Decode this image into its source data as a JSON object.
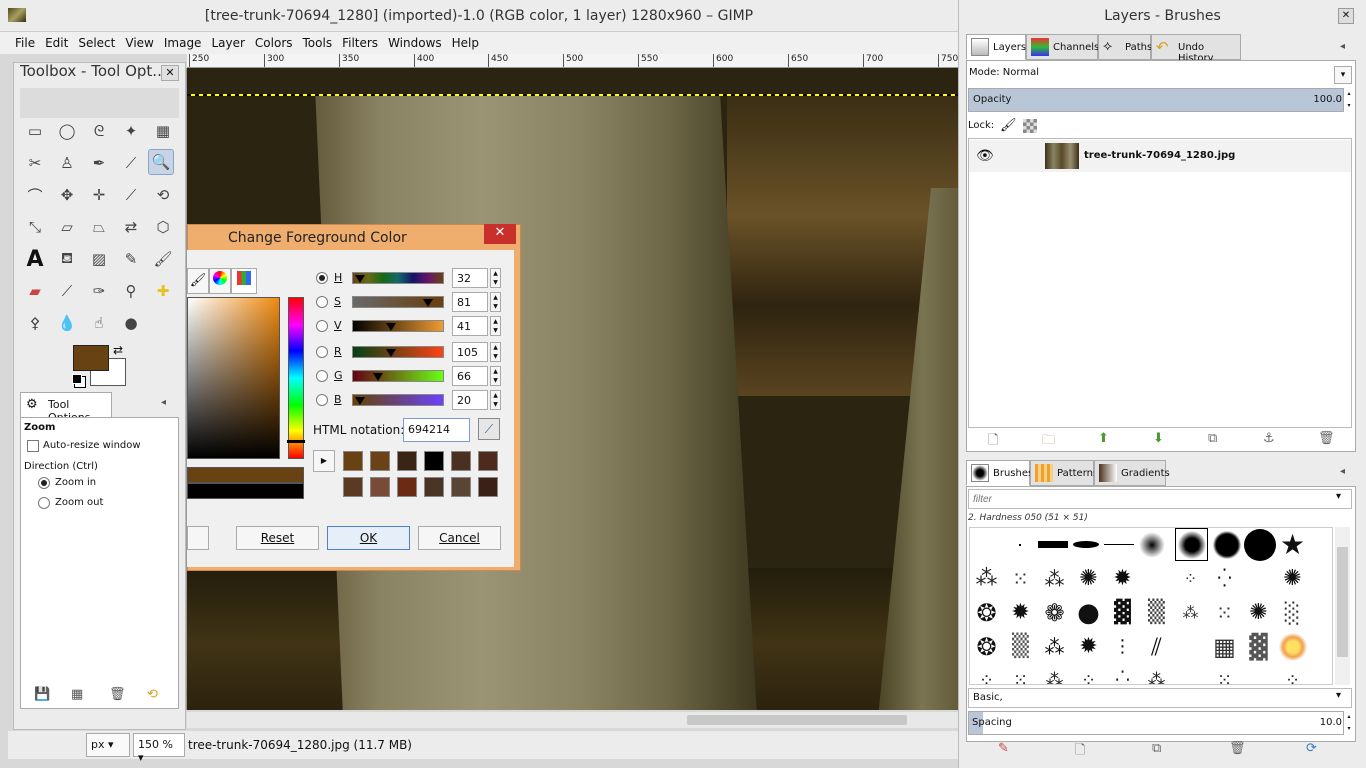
{
  "main_window": {
    "title": "[tree-trunk-70694_1280] (imported)-1.0 (RGB color, 1 layer) 1280x960 – GIMP",
    "menu": [
      "File",
      "Edit",
      "Select",
      "View",
      "Image",
      "Layer",
      "Colors",
      "Tools",
      "Filters",
      "Windows",
      "Help"
    ],
    "ruler_ticks": [
      "250",
      "300",
      "350",
      "400",
      "450",
      "500",
      "550",
      "600",
      "650",
      "700",
      "750"
    ],
    "status": {
      "unit": "px",
      "zoom": "150 %",
      "text": "tree-trunk-70694_1280.jpg (11.7 MB)"
    }
  },
  "toolbox": {
    "title": "Toolbox - Tool Opt...",
    "close": "✕",
    "fg_color": "#694214",
    "bg_color": "#ffffff",
    "tool_options_tab": "Tool Options",
    "tool_name": "Zoom",
    "auto_resize": "Auto-resize window",
    "direction_label": "Direction  (Ctrl)",
    "zoom_in": "Zoom in",
    "zoom_out": "Zoom out"
  },
  "dock": {
    "title": "Layers - Brushes",
    "close": "✕",
    "tabs": [
      "Layers",
      "Channels",
      "Paths",
      "Undo History"
    ],
    "mode_label": "Mode: Normal",
    "opacity_label": "Opacity",
    "opacity_value": "100.0",
    "lock_label": "Lock:",
    "layer_name": "tree-trunk-70694_1280.jpg",
    "brush_tabs": [
      "Brushes",
      "Patterns",
      "Gradients"
    ],
    "filter_placeholder": "filter",
    "brush_info": "2. Hardness 050 (51 × 51)",
    "brush_preset": "Basic,",
    "spacing_label": "Spacing",
    "spacing_value": "10.0"
  },
  "dialog": {
    "title": "Change Foreground Color",
    "close": "✕",
    "channels": [
      {
        "label": "H",
        "value": "32",
        "selected": true
      },
      {
        "label": "S",
        "value": "81",
        "selected": false
      },
      {
        "label": "V",
        "value": "41",
        "selected": false
      },
      {
        "label": "R",
        "value": "105",
        "selected": false
      },
      {
        "label": "G",
        "value": "66",
        "selected": false
      },
      {
        "label": "B",
        "value": "20",
        "selected": false
      }
    ],
    "html_label": "HTML notation:",
    "html_value": "694214",
    "history_colors": [
      "#694214",
      "#6b4218",
      "#3a2414",
      "#000000",
      "#4a3020",
      "#4e2a1c",
      "#5a3a22",
      "#7a4a38",
      "#6a2a14",
      "#4a3426",
      "#5a4434",
      "#3a2016"
    ],
    "buttons": {
      "reset": "Reset",
      "ok": "OK",
      "cancel": "Cancel"
    },
    "new_color": "#694214",
    "old_color": "#000000"
  }
}
